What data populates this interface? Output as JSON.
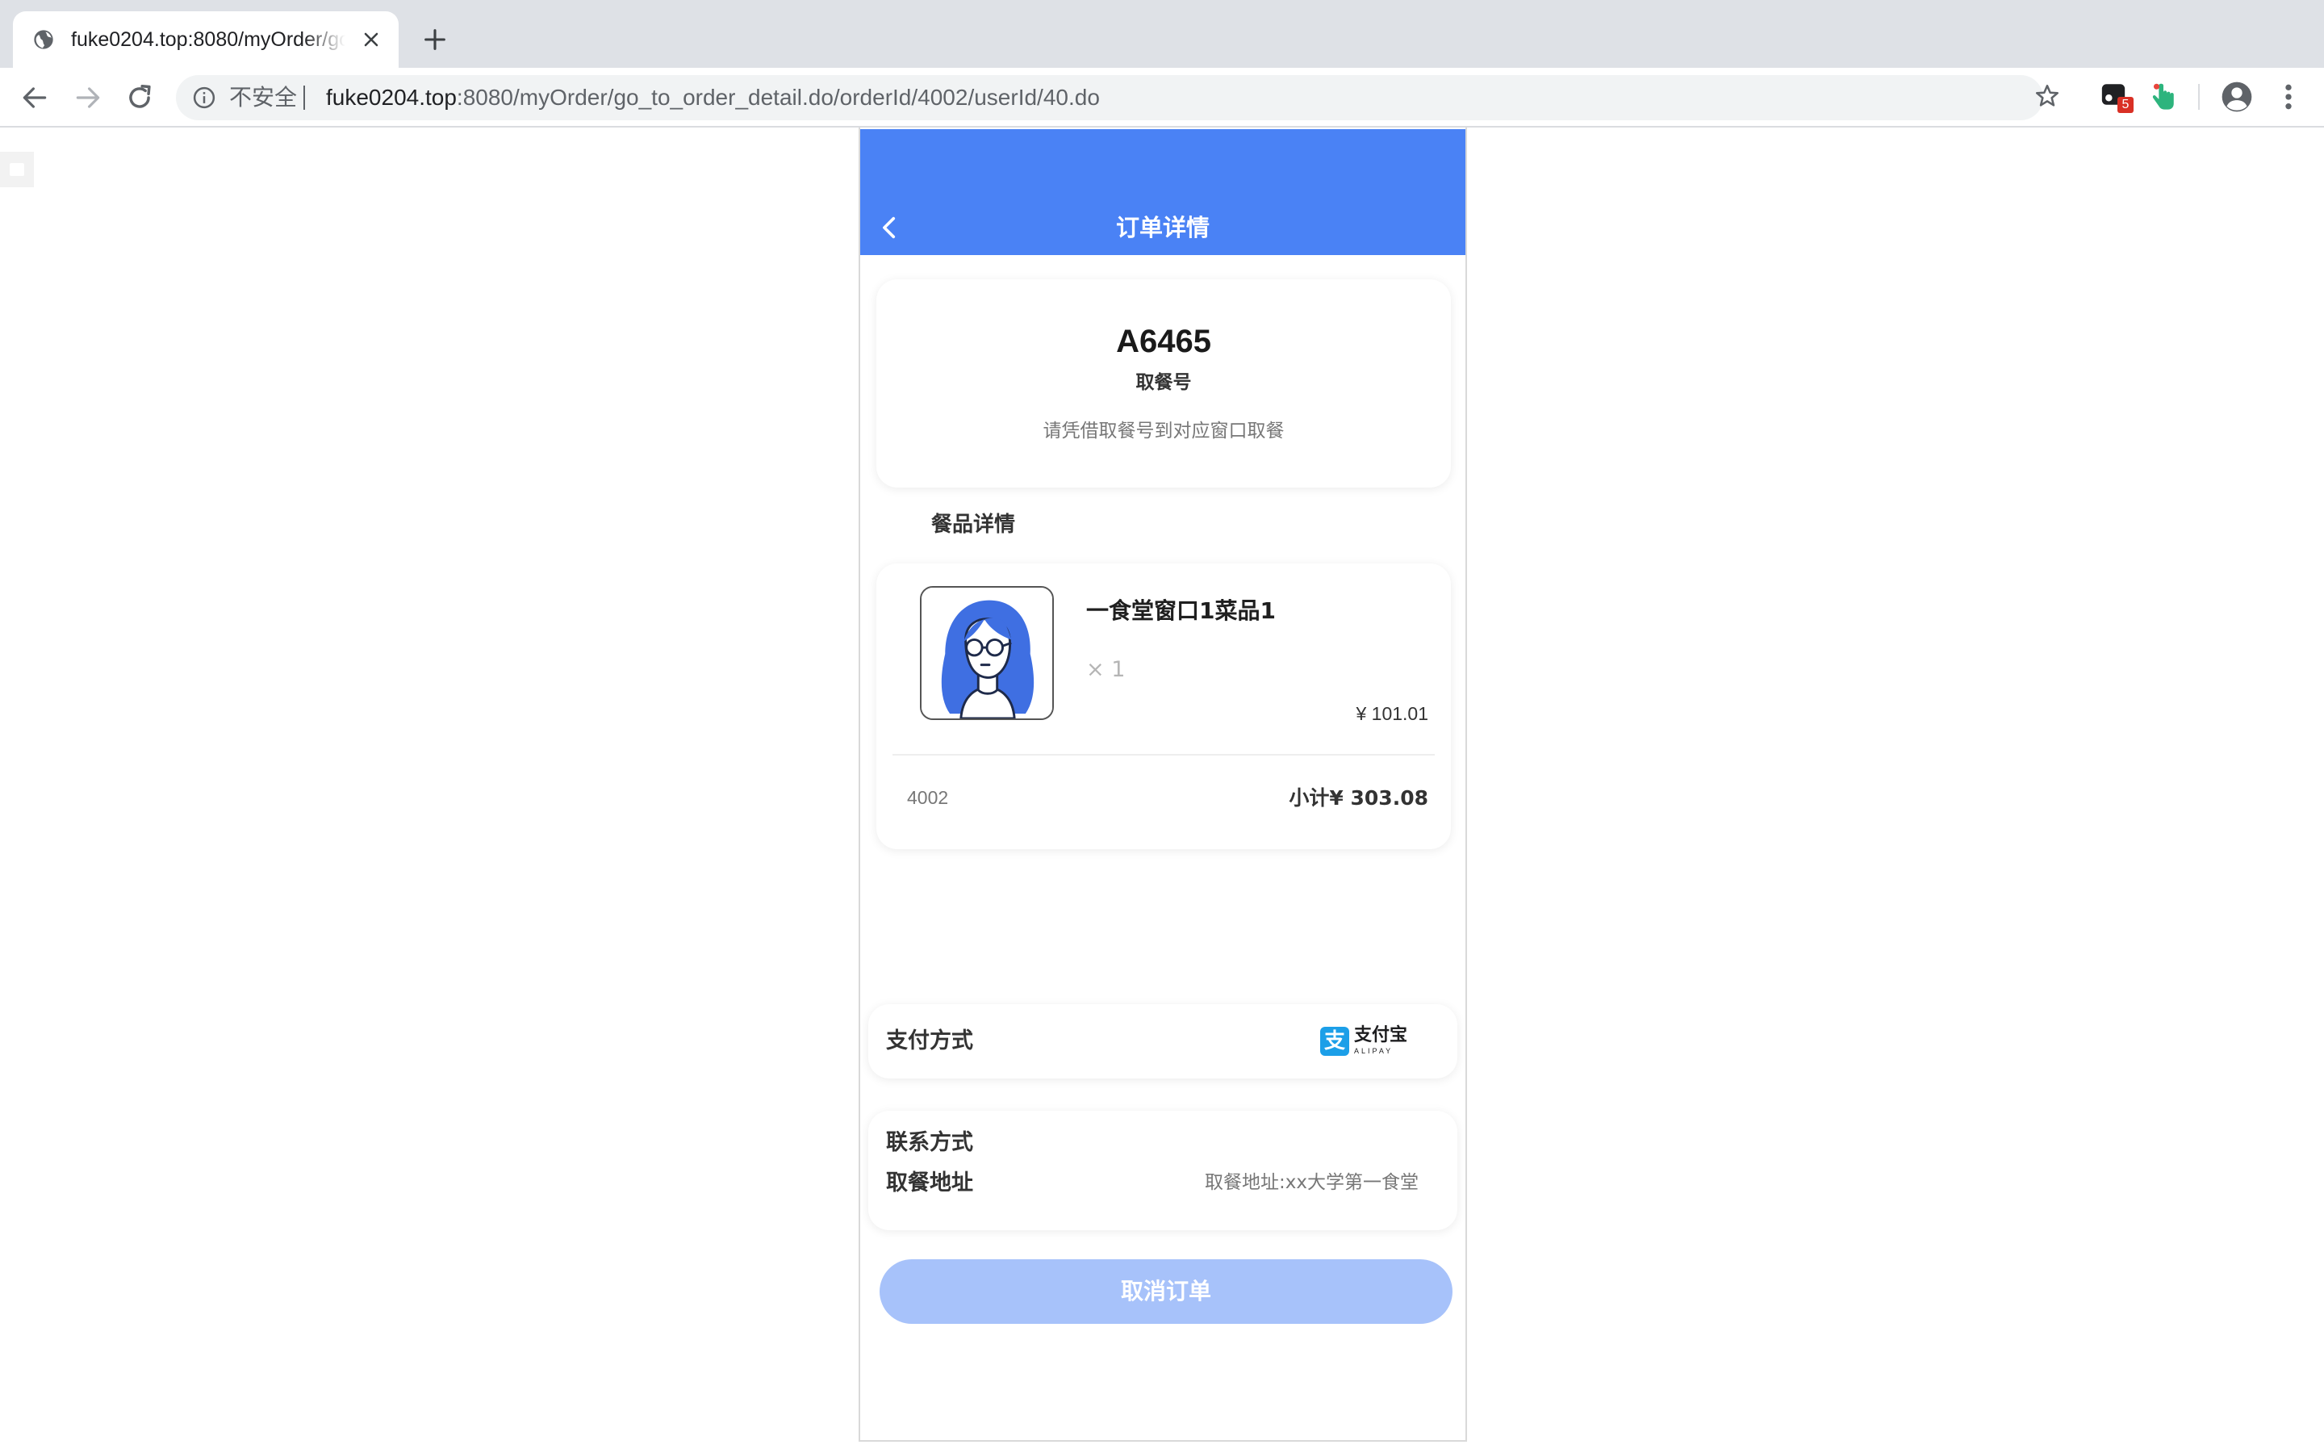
{
  "browser": {
    "tab_title": "fuke0204.top:8080/myOrder/go_to_order_detail.do/orderId/4002/userId/40.do",
    "security_label": "不安全",
    "url_host": "fuke0204.top",
    "url_rest": ":8080/myOrder/go_to_order_detail.do/orderId/4002/userId/40.do",
    "extension_badge": "5"
  },
  "header": {
    "title": "订单详情"
  },
  "pickup": {
    "code": "A6465",
    "label": "取餐号",
    "hint": "请凭借取餐号到对应窗口取餐"
  },
  "food_section": {
    "title": "餐品详情",
    "items": [
      {
        "name": "一食堂窗口1菜品1",
        "quantity": "× 1",
        "price": "¥ 101.01"
      }
    ],
    "order_id": "4002",
    "subtotal": "小计¥ 303.08"
  },
  "payment": {
    "label": "支付方式",
    "method_name": "支付宝",
    "method_sub": "ALIPAY",
    "method_mark": "支"
  },
  "contact": {
    "label": "联系方式",
    "address_label": "取餐地址",
    "address_value": "取餐地址:xx大学第一食堂"
  },
  "actions": {
    "cancel_label": "取消订单"
  },
  "colors": {
    "header_blue": "#4a82f5",
    "cancel_button": "#a7c2fa",
    "alipay_blue": "#1c9fe8",
    "badge_red": "#d93025"
  }
}
